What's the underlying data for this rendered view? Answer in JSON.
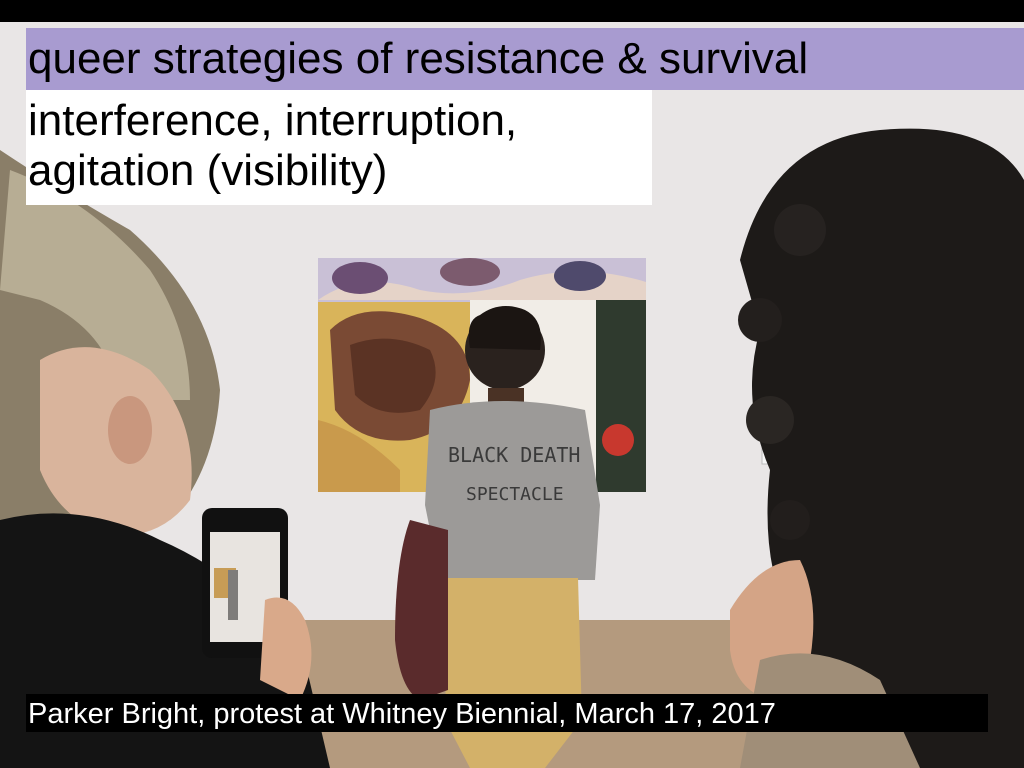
{
  "slide": {
    "title": "queer strategies of resistance & survival",
    "subtitle_lines": [
      "interference, interruption,",
      "agitation (visibility)"
    ],
    "caption": "Parker Bright, protest at Whitney Biennial, March 17, 2017"
  },
  "photo": {
    "shirt_text_line1": "BLACK DEATH",
    "shirt_text_line2": "SPECTACLE"
  },
  "colors": {
    "title_band": "#a89bd0",
    "subtitle_bg": "#ffffff",
    "caption_bg": "#000000",
    "caption_text": "#ffffff"
  }
}
